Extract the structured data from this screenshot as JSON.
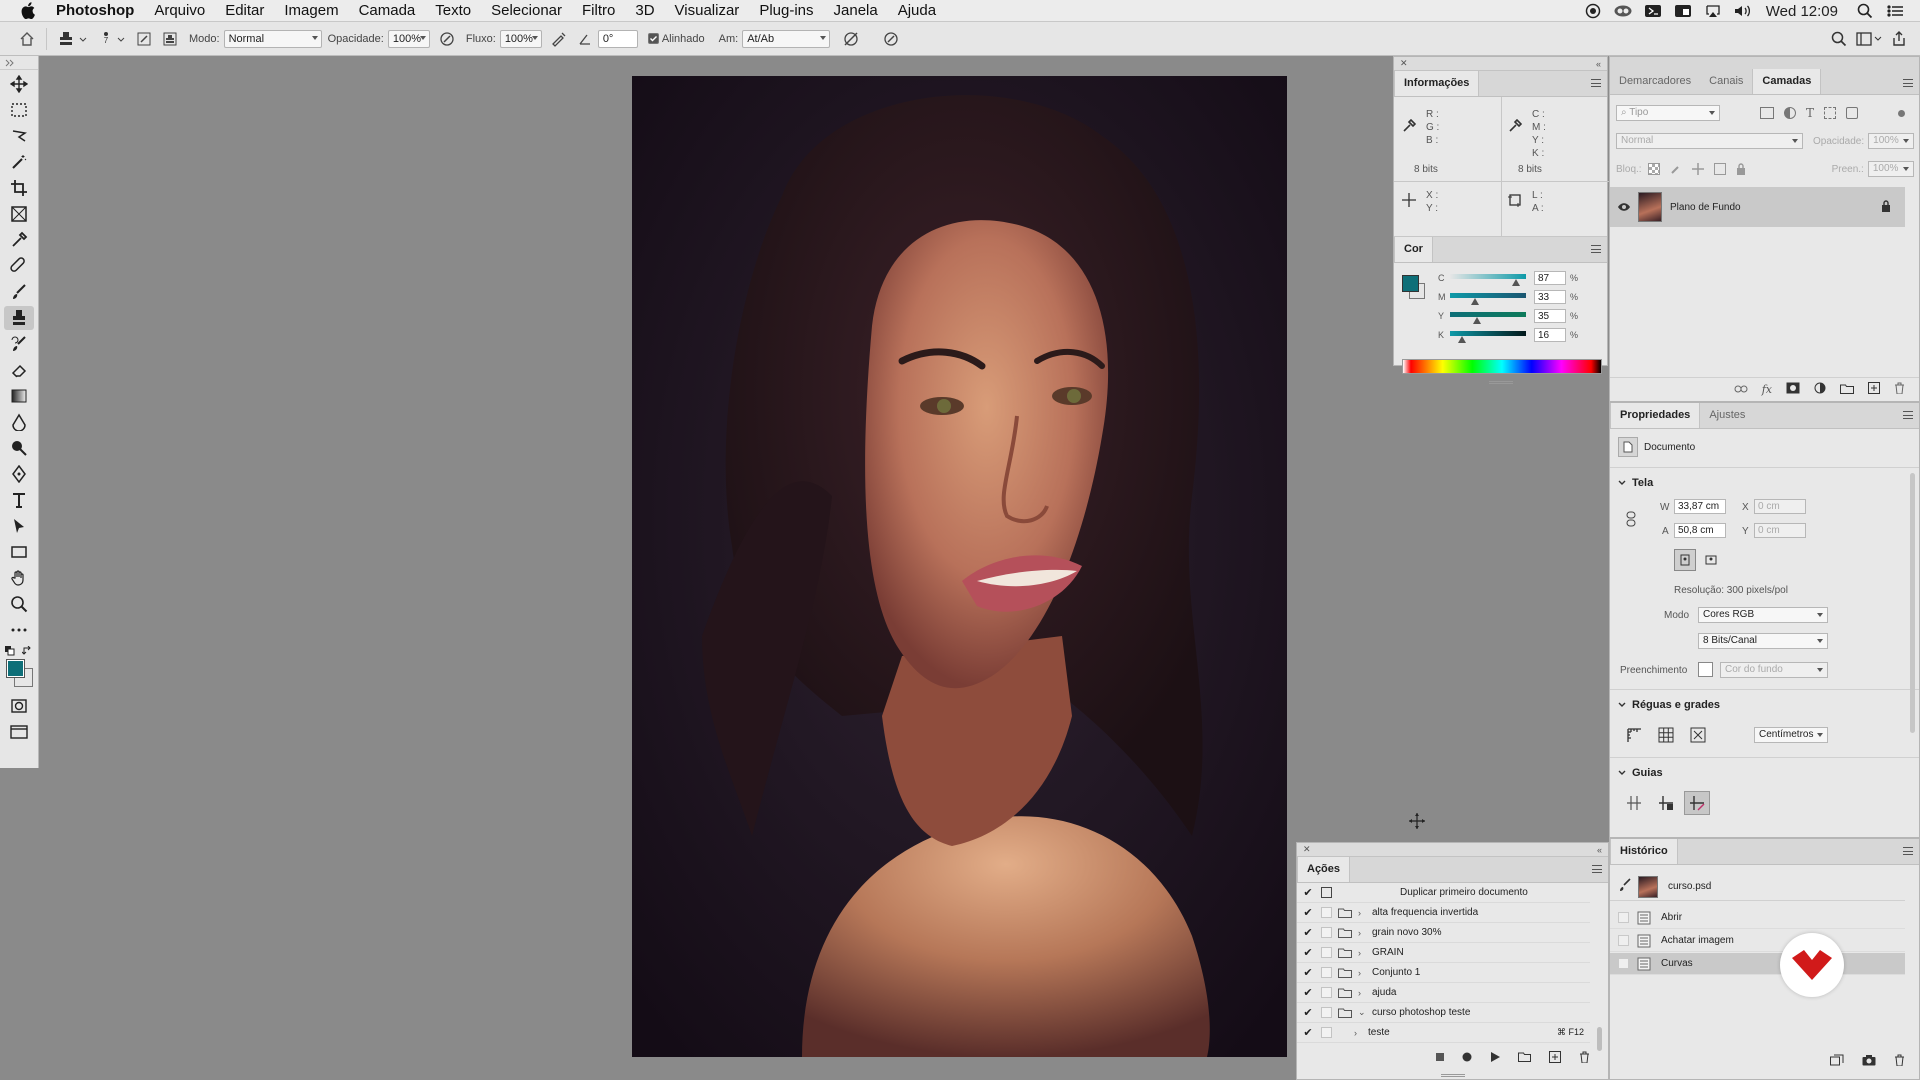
{
  "menubar": {
    "app": "Photoshop",
    "items": [
      "Arquivo",
      "Editar",
      "Imagem",
      "Camada",
      "Texto",
      "Selecionar",
      "Filtro",
      "3D",
      "Visualizar",
      "Plug-ins",
      "Janela",
      "Ajuda"
    ],
    "clock": "Wed 12:09"
  },
  "options": {
    "brush_size": "7",
    "mode_label": "Modo:",
    "mode_value": "Normal",
    "opacity_label": "Opacidade:",
    "opacity_value": "100%",
    "flow_label": "Fluxo:",
    "flow_value": "100%",
    "angle_value": "0°",
    "aligned_label": "Alinhado",
    "sample_label": "Am:",
    "sample_value": "At/Ab"
  },
  "info_panel": {
    "tab": "Informações",
    "rgb": [
      "R :",
      "G :",
      "B :"
    ],
    "cmyk": [
      "C :",
      "M :",
      "Y :",
      "K :"
    ],
    "bits_left": "8 bits",
    "bits_right": "8 bits",
    "xy": [
      "X :",
      "Y :"
    ],
    "la": [
      "L :",
      "A :"
    ]
  },
  "color_panel": {
    "tab": "Cor",
    "foreground": "#0e6f78",
    "sliders": [
      {
        "label": "C",
        "value": "87",
        "unit": "%",
        "fraction": 0.87
      },
      {
        "label": "M",
        "value": "33",
        "unit": "%",
        "fraction": 0.33
      },
      {
        "label": "Y",
        "value": "35",
        "unit": "%",
        "fraction": 0.35
      },
      {
        "label": "K",
        "value": "16",
        "unit": "%",
        "fraction": 0.16
      }
    ]
  },
  "layers_panel": {
    "tabs": [
      "Demarcadores",
      "Canais",
      "Camadas"
    ],
    "active_tab": "Camadas",
    "filter_placeholder": "Tipo",
    "blend_mode": "Normal",
    "opacity_label": "Opacidade:",
    "opacity_value": "100%",
    "lock_label": "Bloq.:",
    "fill_label": "Preen.:",
    "fill_value": "100%",
    "layers": [
      {
        "name": "Plano de Fundo",
        "locked": true
      }
    ]
  },
  "properties_panel": {
    "tabs": [
      "Propriedades",
      "Ajustes"
    ],
    "doc_label": "Documento",
    "canvas_section": "Tela",
    "w_label": "W",
    "w_value": "33,87 cm",
    "h_label": "A",
    "h_value": "50,8 cm",
    "x_label": "X",
    "x_placeholder": "0 cm",
    "y_label": "Y",
    "y_placeholder": "0 cm",
    "resolution": "Resolução: 300 pixels/pol",
    "mode_label": "Modo",
    "mode_value": "Cores RGB",
    "depth_value": "8 Bits/Canal",
    "fill_label": "Preenchimento",
    "fill_value": "Cor do fundo",
    "rulers_section": "Réguas e grades",
    "units_value": "Centímetros",
    "guides_section": "Guias"
  },
  "actions_panel": {
    "tab": "Ações",
    "items": [
      {
        "name": "Duplicar primeiro documento",
        "type": "action-child",
        "checked": true
      },
      {
        "name": "alta frequencia invertida",
        "type": "set",
        "checked": true
      },
      {
        "name": "grain novo 30%",
        "type": "set",
        "checked": true
      },
      {
        "name": "GRAIN",
        "type": "set",
        "checked": true
      },
      {
        "name": "Conjunto 1",
        "type": "set",
        "checked": true
      },
      {
        "name": "ajuda",
        "type": "set",
        "checked": true
      },
      {
        "name": "curso photoshop teste",
        "type": "set-open",
        "checked": true
      },
      {
        "name": "teste",
        "type": "action",
        "checked": true,
        "shortcut": "⌘ F12"
      }
    ]
  },
  "history_panel": {
    "tab": "Histórico",
    "snapshot": "curso.psd",
    "items": [
      {
        "name": "Abrir",
        "selected": false
      },
      {
        "name": "Achatar imagem",
        "selected": false
      },
      {
        "name": "Curvas",
        "selected": true
      }
    ]
  }
}
